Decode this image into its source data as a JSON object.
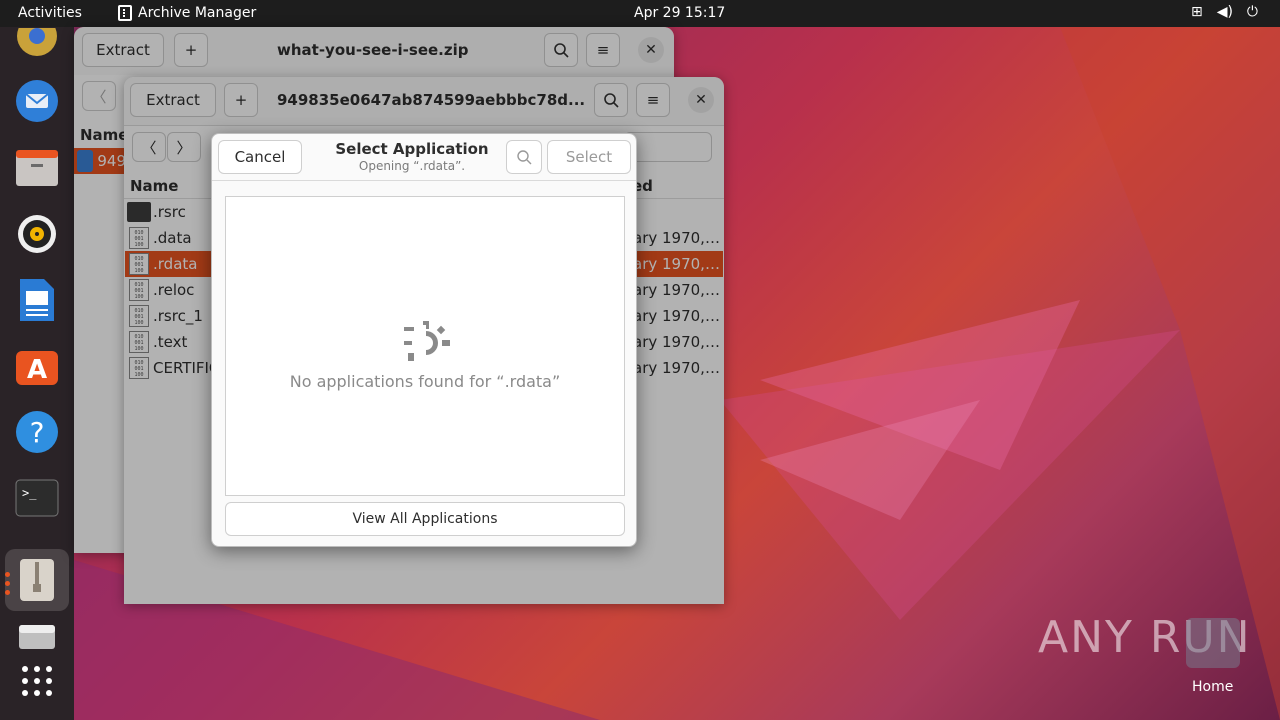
{
  "topbar": {
    "activities": "Activities",
    "app_name": "Archive Manager",
    "clock": "Apr 29  15:17",
    "tray_icons": [
      "network-icon",
      "volume-icon",
      "power-icon"
    ]
  },
  "dock": {
    "items": [
      "chrome-icon",
      "thunderbird-icon",
      "files-icon",
      "rhythmbox-icon",
      "writer-icon",
      "app-center-icon",
      "help-icon",
      "terminal-icon",
      "archive-manager-icon",
      "drive-icon",
      "app-grid-icon"
    ]
  },
  "back_window": {
    "extract_label": "Extract",
    "add_label": "+",
    "title": "what-you-see-i-see.zip",
    "col_name": "Name",
    "selected_item": "949"
  },
  "front_window": {
    "extract_label": "Extract",
    "add_label": "+",
    "title": "949835e0647ab874599aebbbc78d...",
    "col_name": "Name",
    "col_modified": "ed",
    "files": [
      {
        "name": ".rsrc",
        "type": "folder",
        "modified": ""
      },
      {
        "name": ".data",
        "type": "binary",
        "modified": "ary 1970,…"
      },
      {
        "name": ".rdata",
        "type": "binary",
        "modified": "ary 1970,…",
        "selected": true
      },
      {
        "name": ".reloc",
        "type": "binary",
        "modified": "ary 1970,…"
      },
      {
        "name": ".rsrc_1",
        "type": "binary",
        "modified": "ary 1970,…"
      },
      {
        "name": ".text",
        "type": "binary",
        "modified": "ary 1970,…"
      },
      {
        "name": "CERTIFIC",
        "type": "binary",
        "modified": "ary 1970,…"
      }
    ]
  },
  "dialog": {
    "cancel_label": "Cancel",
    "title": "Select Application",
    "subtitle": "Opening “.rdata”.",
    "select_label": "Select",
    "empty_message": "No applications found for “.rdata”",
    "view_all_label": "View All Applications"
  },
  "desktop": {
    "home_label": "Home",
    "watermark": "ANY RUN"
  },
  "colors": {
    "accent": "#e95420",
    "topbar": "#1d1d1d",
    "dock": "#2a2327"
  }
}
